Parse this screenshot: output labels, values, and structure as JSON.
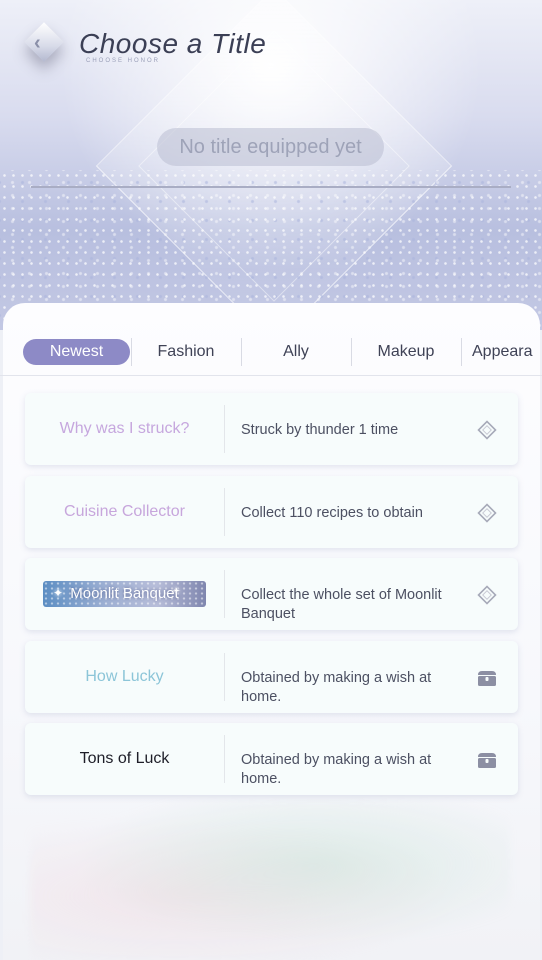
{
  "header": {
    "title": "Choose a Title",
    "subtitle": "CHOOSE HONOR",
    "equipped_status": "No title equipped yet"
  },
  "tabs": [
    {
      "label": "Newest",
      "active": true
    },
    {
      "label": "Fashion",
      "active": false
    },
    {
      "label": "Ally",
      "active": false
    },
    {
      "label": "Makeup",
      "active": false
    },
    {
      "label": "Appeara",
      "active": false
    }
  ],
  "titles": [
    {
      "name": "Why was I struck?",
      "description": "Struck by thunder 1 time",
      "icon": "diamond-outline-icon",
      "color": "#c6a7de"
    },
    {
      "name": "Cuisine Collector",
      "description": "Collect 110 recipes to obtain",
      "icon": "diamond-outline-icon",
      "color": "#c7a6dc"
    },
    {
      "name": "Moonlit Banquet",
      "description": "Collect the whole set of Moonlit Banquet",
      "icon": "diamond-outline-icon",
      "color": "#ffffff"
    },
    {
      "name": "How Lucky",
      "description": "Obtained by making a wish at home.",
      "icon": "chest-icon",
      "color": "#8cc5d8"
    },
    {
      "name": "Tons of Luck",
      "description": "Obtained by making a wish at home.",
      "icon": "chest-icon",
      "color": "#1e1e28"
    }
  ],
  "colors": {
    "accent": "#8d8ac6",
    "icon_gray": "#8c8fa3"
  }
}
